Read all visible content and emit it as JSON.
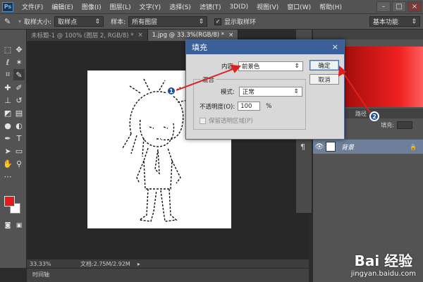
{
  "app": {
    "logo": "Ps"
  },
  "menu": [
    "文件(F)",
    "编辑(E)",
    "图像(I)",
    "图层(L)",
    "文字(Y)",
    "选择(S)",
    "滤镜(T)",
    "3D(D)",
    "视图(V)",
    "窗口(W)",
    "帮助(H)"
  ],
  "window_controls": {
    "minimize": "–",
    "restore": "□",
    "close": "×"
  },
  "options": {
    "tool_icon": "eyedropper-icon",
    "sample_size_label": "取样大小:",
    "sample_size_value": "取样点",
    "sample_label": "样本:",
    "sample_value": "所有图层",
    "show_ring_label": "显示取样环",
    "show_ring_checked": true,
    "workspace": "基本功能"
  },
  "tabs": [
    {
      "label": "未标题-1 @ 100% (图层 2, RGB/8) *",
      "close": "×"
    },
    {
      "label": "1.jpg @ 33.3%(RGB/8) *",
      "close": "×"
    }
  ],
  "status": {
    "zoom": "33.33%",
    "doc": "文档:2.75M/2.92M"
  },
  "timeline": {
    "label": "时间轴"
  },
  "right_panel": {
    "layers_tab": "路径",
    "fill_label": "填充:",
    "layer_name": "背景",
    "lock": "🔒"
  },
  "colors": {
    "foreground": "#e21b1b",
    "background": "#ffffff",
    "accent": "#3b5f98",
    "annotation": "#e02020"
  },
  "dialog": {
    "title": "填充",
    "close": "×",
    "content_label": "内容:",
    "content_value": "前景色",
    "blend_group": "混合",
    "mode_label": "模式:",
    "mode_value": "正常",
    "opacity_label": "不透明度(O):",
    "opacity_value": "100",
    "opacity_unit": "%",
    "preserve_label": "保留透明区域(P)",
    "ok": "确定",
    "cancel": "取消"
  },
  "annotations": {
    "badge1": "1",
    "badge2": "2"
  },
  "watermark": {
    "logo": "Bai 经验",
    "url": "jingyan.baidu.com"
  }
}
